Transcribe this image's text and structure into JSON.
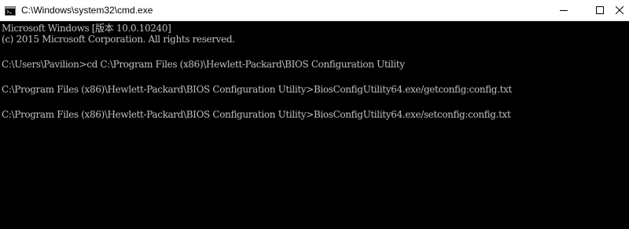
{
  "window": {
    "title": "C:\\Windows\\system32\\cmd.exe",
    "icon": "console-icon"
  },
  "controls": {
    "minimize_icon": "minimize-icon",
    "maximize_icon": "maximize-icon",
    "close_icon": "close-icon"
  },
  "console": {
    "lines": [
      "Microsoft Windows [版本 10.0.10240]",
      "(c) 2015 Microsoft Corporation. All rights reserved.",
      "C:\\Users\\Pavilion>cd C:\\Program Files (x86)\\Hewlett-Packard\\BIOS Configuration Utility",
      "C:\\Program Files (x86)\\Hewlett-Packard\\BIOS Configuration Utility>BiosConfigUtility64.exe/getconfig:config.txt",
      "C:\\Program Files (x86)\\Hewlett-Packard\\BIOS Configuration Utility>BiosConfigUtility64.exe/setconfig:config.txt"
    ]
  },
  "colors": {
    "console_bg": "#000000",
    "console_fg": "#c0c0c0",
    "titlebar_bg": "#ffffff"
  }
}
